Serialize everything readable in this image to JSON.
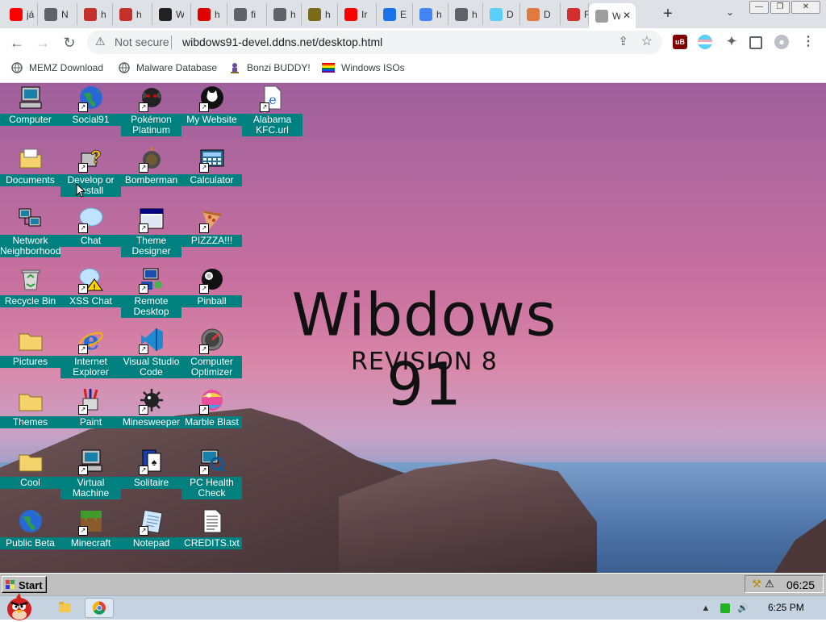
{
  "browser": {
    "tabs": [
      {
        "label": "já",
        "icon": "youtube-icon",
        "color": "#ff0000"
      },
      {
        "label": "N",
        "icon": "globe-icon",
        "color": "#5f6368"
      },
      {
        "label": "h",
        "icon": "youtube-logo-icon",
        "color": "#c4302b"
      },
      {
        "label": "h",
        "icon": "youtube-logo-icon",
        "color": "#c4302b"
      },
      {
        "label": "W",
        "icon": "wikipedia-icon",
        "color": "#222222"
      },
      {
        "label": "h",
        "icon": "adobe-icon",
        "color": "#e00000"
      },
      {
        "label": "fi",
        "icon": "globe-icon",
        "color": "#5f6368"
      },
      {
        "label": "h",
        "icon": "globe-icon",
        "color": "#5f6368"
      },
      {
        "label": "h",
        "icon": "chart-icon",
        "color": "#7a6a1a"
      },
      {
        "label": "Ir",
        "icon": "youtube-icon",
        "color": "#ff0000"
      },
      {
        "label": "E",
        "icon": "puzzle-icon",
        "color": "#1a73e8"
      },
      {
        "label": "h",
        "icon": "google-icon",
        "color": "#4285f4"
      },
      {
        "label": "h",
        "icon": "globe-icon",
        "color": "#5f6368"
      },
      {
        "label": "D",
        "icon": "trans-flag-icon",
        "color": "#5bcefa"
      },
      {
        "label": "D",
        "icon": "rainbow-icon",
        "color": "#e07a3e"
      },
      {
        "label": "R",
        "icon": "dislike-icon",
        "color": "#d32f2f"
      },
      {
        "label": "W",
        "icon": "page-icon",
        "color": "#9e9e9e",
        "active": true
      }
    ],
    "url_warning": "Not secure",
    "url": "wibdows91-devel.ddns.net/desktop.html",
    "bookmarks": [
      {
        "label": "MEMZ Download",
        "icon": "globe-icon"
      },
      {
        "label": "Malware Database",
        "icon": "globe-icon"
      },
      {
        "label": "Bonzi BUDDY!",
        "icon": "bonzi-icon"
      },
      {
        "label": "Windows ISOs",
        "icon": "windows-flag-icon"
      }
    ]
  },
  "desktop": {
    "title": "Wibdows 91",
    "subtitle": "REVISION 8",
    "icons": [
      {
        "label": "Computer",
        "icon": "computer-icon",
        "shortcut": false
      },
      {
        "label": "Social91",
        "icon": "globe-icon",
        "shortcut": true
      },
      {
        "label": "Pokémon Platinum",
        "icon": "pokemon-icon",
        "shortcut": true
      },
      {
        "label": "My Website",
        "icon": "github-icon",
        "shortcut": true
      },
      {
        "label": "Alabama KFC.url",
        "icon": "ie-document-icon",
        "shortcut": true
      },
      {
        "label": "Documents",
        "icon": "documents-folder-icon",
        "shortcut": false
      },
      {
        "label": "Develop or Install",
        "icon": "help-icon",
        "shortcut": true
      },
      {
        "label": "Bomberman",
        "icon": "bomberman-icon",
        "shortcut": true
      },
      {
        "label": "Calculator",
        "icon": "calculator-icon",
        "shortcut": true
      },
      {
        "label": "Network Neighborhood",
        "icon": "network-icon",
        "shortcut": false
      },
      {
        "label": "Chat",
        "icon": "chat-icon",
        "shortcut": true
      },
      {
        "label": "Theme Designer",
        "icon": "window-icon",
        "shortcut": true
      },
      {
        "label": "PIZZZA!!!",
        "icon": "pizza-icon",
        "shortcut": true
      },
      {
        "label": "Recycle Bin",
        "icon": "recycle-bin-icon",
        "shortcut": false
      },
      {
        "label": "XSS Chat",
        "icon": "warning-chat-icon",
        "shortcut": true
      },
      {
        "label": "Remote Desktop",
        "icon": "remote-desktop-icon",
        "shortcut": true
      },
      {
        "label": "Pinball",
        "icon": "pinball-icon",
        "shortcut": true
      },
      {
        "label": "Pictures",
        "icon": "folder-icon",
        "shortcut": false
      },
      {
        "label": "Internet Explorer",
        "icon": "ie-icon",
        "shortcut": true
      },
      {
        "label": "Visual Studio Code",
        "icon": "vscode-icon",
        "shortcut": true
      },
      {
        "label": "Computer Optimizer",
        "icon": "gauge-icon",
        "shortcut": true
      },
      {
        "label": "Themes",
        "icon": "folder-icon",
        "shortcut": false
      },
      {
        "label": "Paint",
        "icon": "paint-icon",
        "shortcut": true
      },
      {
        "label": "Minesweeper",
        "icon": "mine-icon",
        "shortcut": true
      },
      {
        "label": "Marble Blast",
        "icon": "marble-icon",
        "shortcut": true
      },
      {
        "label": "Cool",
        "icon": "folder-icon",
        "shortcut": false
      },
      {
        "label": "Virtual Machine",
        "icon": "computer-icon",
        "shortcut": true
      },
      {
        "label": "Solitaire",
        "icon": "cards-icon",
        "shortcut": true
      },
      {
        "label": "PC Health Check",
        "icon": "health-check-icon",
        "shortcut": true
      },
      {
        "label": "Public Beta",
        "icon": "globe-icon",
        "shortcut": false
      },
      {
        "label": "Minecraft",
        "icon": "grass-block-icon",
        "shortcut": true
      },
      {
        "label": "Notepad",
        "icon": "notepad-icon",
        "shortcut": true
      },
      {
        "label": "CREDITS.txt",
        "icon": "text-file-icon",
        "shortcut": false
      }
    ]
  },
  "taskbar": {
    "start_label": "Start",
    "clock": "06:25"
  },
  "os_taskbar": {
    "clock": "6:25 PM"
  },
  "colors": {
    "icon_label_bg": "#00807f",
    "taskbar_gray": "#c0c0c0"
  }
}
